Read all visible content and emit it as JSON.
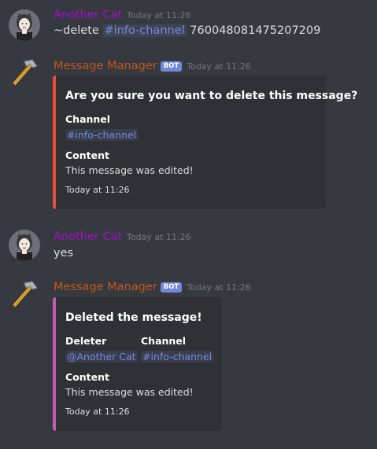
{
  "messages": [
    {
      "author": "Another Cat",
      "timestamp": "Today at 11:26",
      "content_prefix": "~delete",
      "content_mention": "#info-channel",
      "content_suffix": "760048081475207209"
    },
    {
      "author": "Message Manager",
      "bot_tag": "BOT",
      "timestamp": "Today at 11:26",
      "embed": {
        "title": "Are you sure you want to delete this message?",
        "fields": [
          {
            "name": "Channel",
            "value": "#info-channel"
          },
          {
            "name": "Content",
            "value": "This message was edited!"
          }
        ],
        "footer": "Today at 11:26",
        "color": "#e74c3c"
      }
    },
    {
      "author": "Another Cat",
      "timestamp": "Today at 11:26",
      "content": "yes"
    },
    {
      "author": "Message Manager",
      "bot_tag": "BOT",
      "timestamp": "Today at 11:26",
      "embed": {
        "title": "Deleted the message!",
        "fields": [
          {
            "name": "Deleter",
            "value": "@Another Cat"
          },
          {
            "name": "Channel",
            "value": "#info-channel"
          },
          {
            "name": "Content",
            "value": "This message was edited!"
          }
        ],
        "footer": "Today at 11:26",
        "color": "#c45ab6"
      }
    }
  ],
  "colors": {
    "background": "#36393f",
    "embed_background": "#2f3136",
    "user_name": "#a00fcc",
    "bot_name": "#c0561c",
    "bot_tag": "#7289da",
    "mention": "#7289da"
  },
  "icons": {
    "user_avatar": "cat-avatar-icon",
    "bot_avatar": "hammer-icon"
  }
}
